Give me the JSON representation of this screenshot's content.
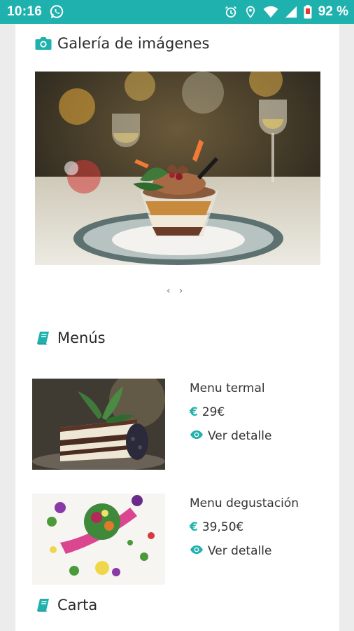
{
  "status_bar": {
    "time": "10:16",
    "battery": "92 %",
    "icons": [
      "whatsapp-icon",
      "alarm-icon",
      "location-icon",
      "wifi-icon",
      "signal-icon",
      "battery-icon"
    ]
  },
  "gallery": {
    "title": "Galería de imágenes",
    "icon": "camera-icon",
    "prev": "‹",
    "next": "›"
  },
  "menus": {
    "title": "Menús",
    "icon": "book-icon",
    "items": [
      {
        "name": "Menu termal",
        "price": "29€",
        "detail_label": "Ver detalle"
      },
      {
        "name": "Menu degustación",
        "price": "39,50€",
        "detail_label": "Ver detalle"
      }
    ]
  },
  "carta": {
    "title": "Carta",
    "icon": "book-icon"
  },
  "colors": {
    "accent": "#1fb1ae"
  }
}
